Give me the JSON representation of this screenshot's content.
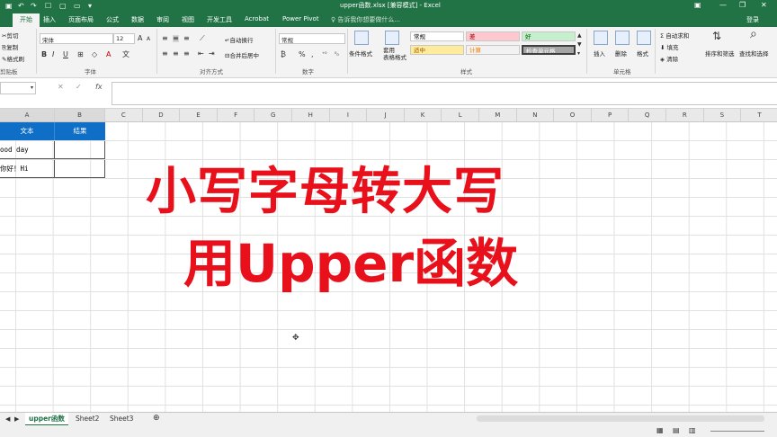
{
  "window": {
    "title": "upper函数.xlsx [兼容模式] - Excel",
    "login": "登录"
  },
  "ribbon_tabs": [
    "开始",
    "插入",
    "页面布局",
    "公式",
    "数据",
    "审阅",
    "视图",
    "开发工具",
    "Acrobat",
    "Power Pivot"
  ],
  "tell_me": "告诉我你想要做什么...",
  "clipboard": {
    "cut": "剪切",
    "copy": "复制",
    "format_painter": "格式刷",
    "group": "剪贴板"
  },
  "font": {
    "name": "宋体",
    "size": "12",
    "group": "字体"
  },
  "alignment": {
    "wrap": "自动换行",
    "merge": "合并后居中",
    "group": "对齐方式"
  },
  "number": {
    "format": "常规",
    "group": "数字"
  },
  "styles": {
    "conditional": "条件格式",
    "table": "套用\n表格格式",
    "cells": [
      "常规",
      "差",
      "好",
      "适中",
      "计算",
      "检查单元格"
    ],
    "group": "样式"
  },
  "cells_group": {
    "insert": "插入",
    "delete": "删除",
    "format": "格式",
    "group": "单元格"
  },
  "editing": {
    "autosum": "自动求和",
    "fill": "填充",
    "clear": "清除",
    "sort": "排序和筛选",
    "find": "查找和选择"
  },
  "columns": [
    "A",
    "B",
    "C",
    "D",
    "E",
    "F",
    "G",
    "H",
    "I",
    "J",
    "K",
    "L",
    "M",
    "N",
    "O",
    "P",
    "Q",
    "R",
    "S",
    "T"
  ],
  "table": {
    "headers": [
      "文本",
      "结果"
    ],
    "rows": [
      [
        "ood day",
        ""
      ],
      [
        "你好！Hi",
        ""
      ]
    ]
  },
  "overlay": {
    "line1": "小写字母转大写",
    "line2": "用Upper函数"
  },
  "sheets": [
    "upper函数",
    "Sheet2",
    "Sheet3"
  ],
  "colors": {
    "excel_green": "#217346",
    "header_blue": "#0f6fc6",
    "overlay_red": "#e8101b"
  }
}
